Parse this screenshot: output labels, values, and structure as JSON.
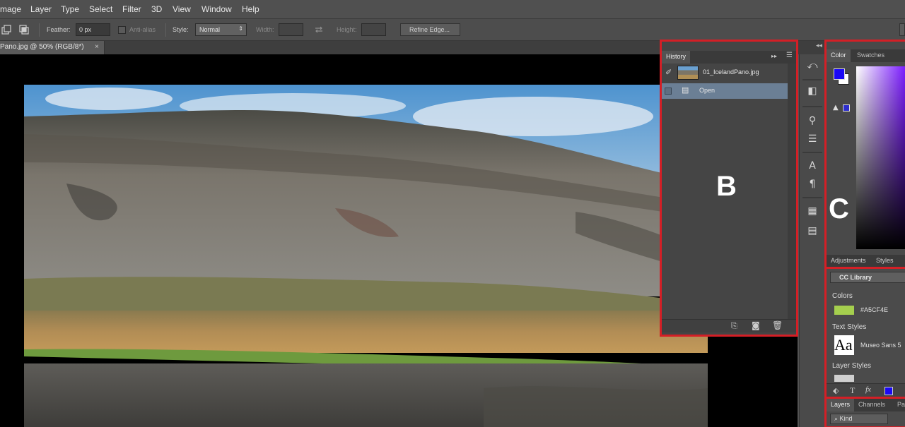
{
  "menubar": {
    "items": [
      "mage",
      "Layer",
      "Type",
      "Select",
      "Filter",
      "3D",
      "View",
      "Window",
      "Help"
    ]
  },
  "options": {
    "feather_label": "Feather:",
    "feather_value": "0 px",
    "antialias_label": "Anti-alias",
    "style_label": "Style:",
    "style_value": "Normal",
    "width_label": "Width:",
    "height_label": "Height:",
    "refine_label": "Refine Edge...",
    "swap_icon": "swap-arrows-icon"
  },
  "document": {
    "tab_title": "Pano.jpg @ 50% (RGB/8*)",
    "close_glyph": "×"
  },
  "history": {
    "tab_label": "History",
    "menu_glyph": "▸▸",
    "snapshot_name": "01_IcelandPano.jpg",
    "state_label": "Open",
    "callout": "B"
  },
  "color": {
    "tab_color": "Color",
    "tab_swatches": "Swatches",
    "tab_adjustments": "Adjustments",
    "tab_styles": "Styles",
    "foreground": "#1a08f5",
    "callout": "C"
  },
  "cc_library": {
    "dropdown": "CC Library",
    "colors_heading": "Colors",
    "color_hex": "#A5CF4E",
    "swatch": "#a5cf4e",
    "text_styles_heading": "Text Styles",
    "text_style_name": "Museo Sans 5",
    "text_style_glyph": "Aa",
    "layer_styles_heading": "Layer Styles"
  },
  "layers": {
    "tab_layers": "Layers",
    "tab_channels": "Channels",
    "tab_paths": "Pa",
    "kind_label": "Kind"
  },
  "colors": {
    "highlight": "#d41f26"
  }
}
